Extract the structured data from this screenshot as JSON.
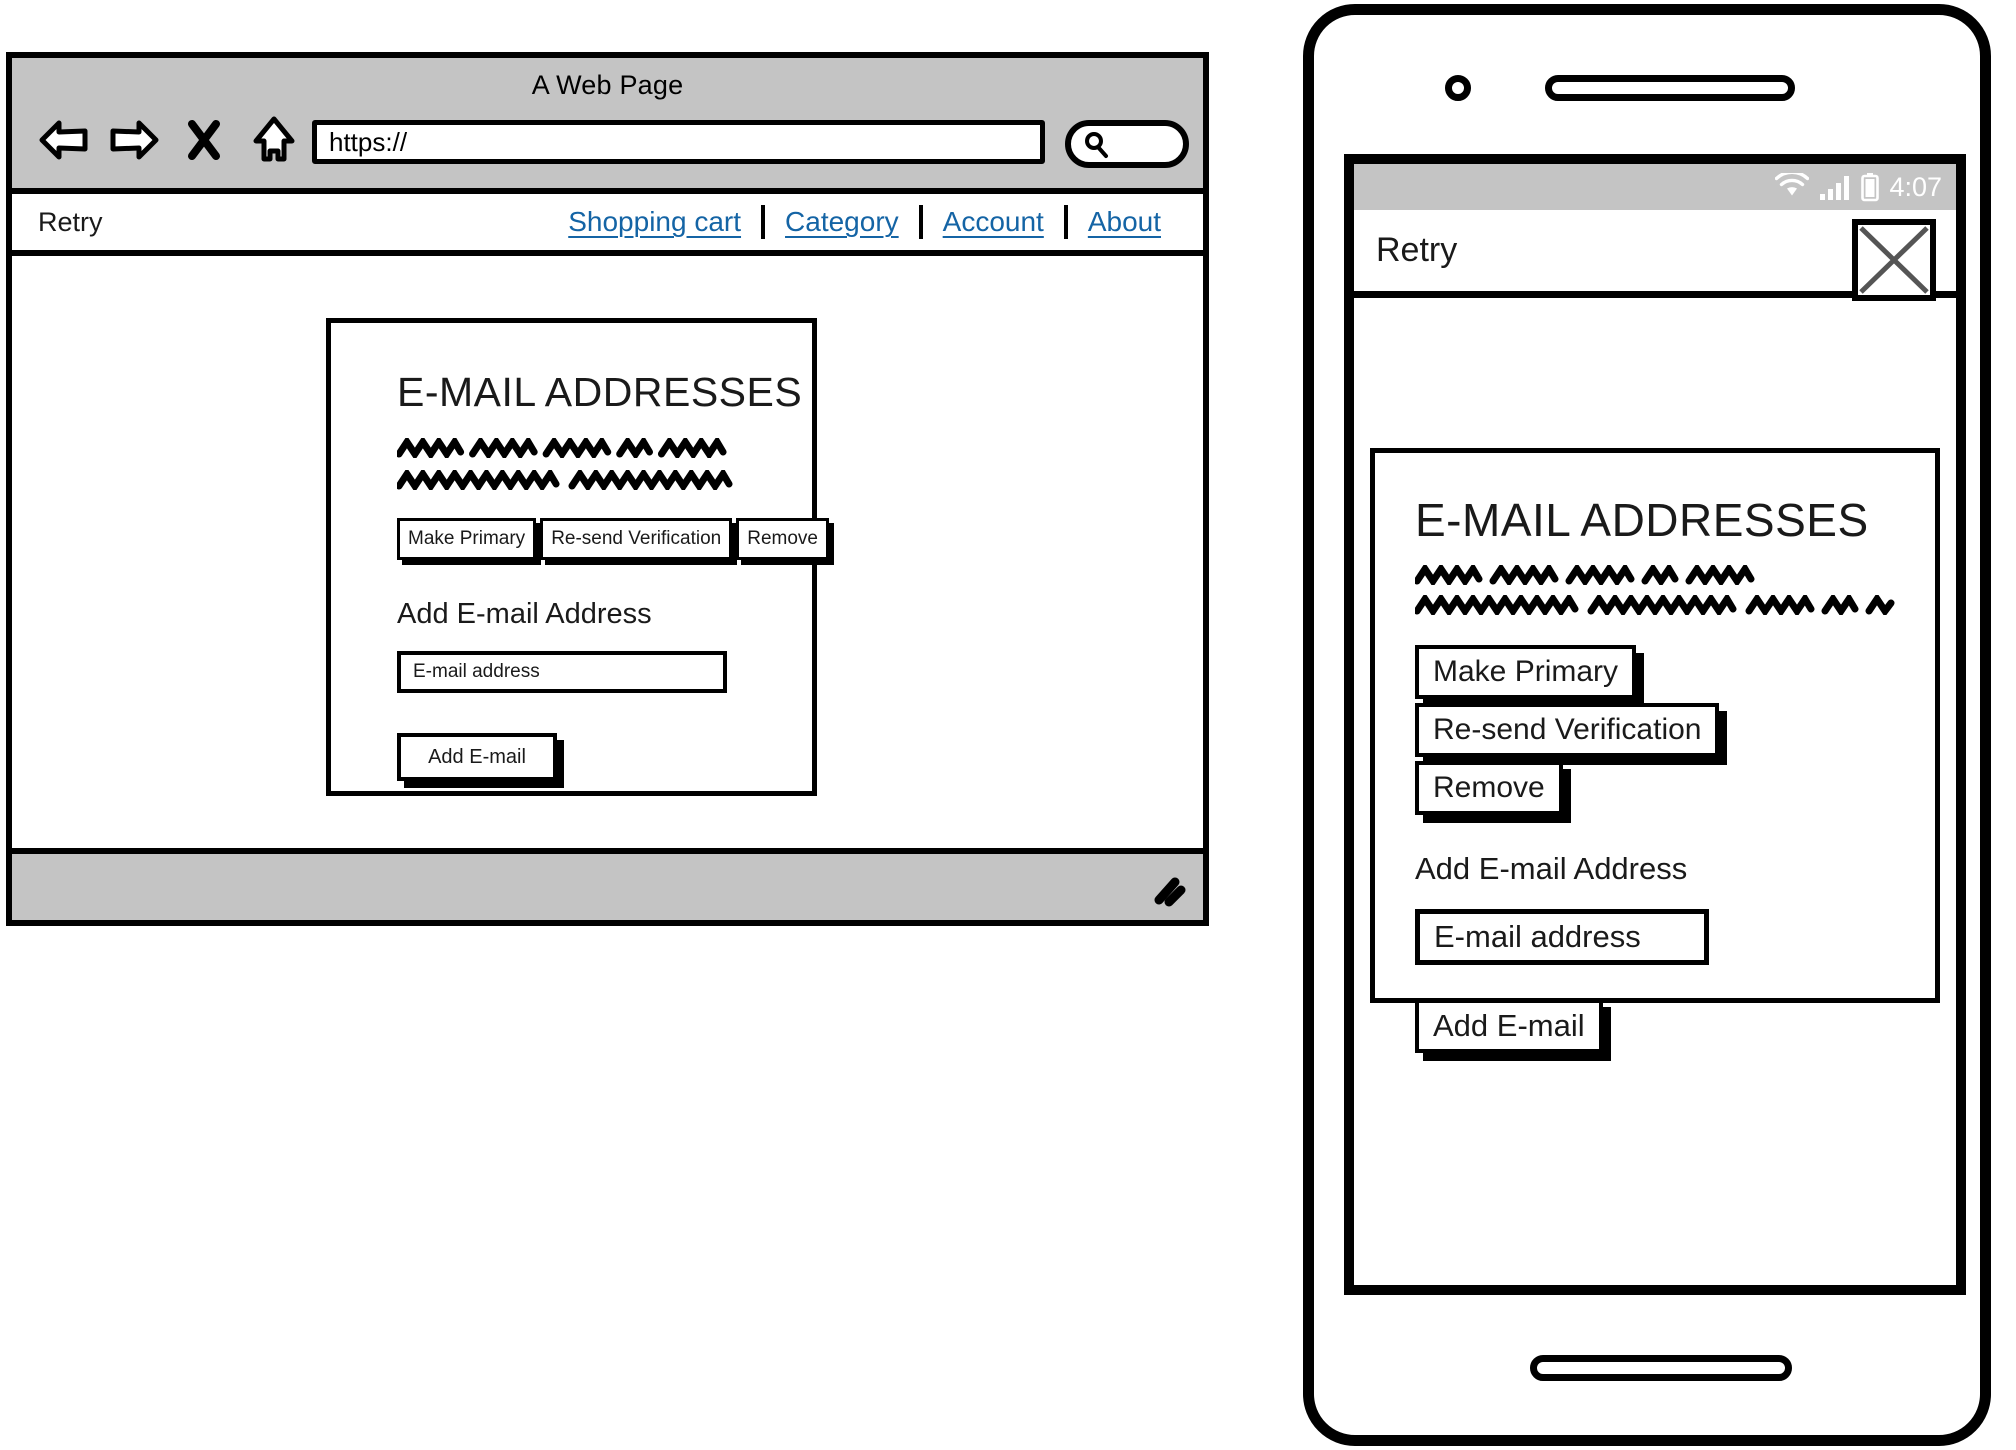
{
  "browser": {
    "title": "A Web Page",
    "url_value": "https://",
    "url_placeholder": "https://",
    "controls": [
      {
        "name": "back-arrow-icon",
        "label": "Back"
      },
      {
        "name": "forward-arrow-icon",
        "label": "Forward"
      },
      {
        "name": "close-x-icon",
        "label": "Stop"
      },
      {
        "name": "home-icon",
        "label": "Home"
      }
    ],
    "search": {
      "icon": "search-icon",
      "value": "",
      "placeholder": ""
    },
    "statusbar": {
      "resize_grip": "resize-grip-icon"
    }
  },
  "site_nav": {
    "brand": "Retry",
    "links": [
      {
        "label": "Shopping cart"
      },
      {
        "label": "Category"
      },
      {
        "label": "Account"
      },
      {
        "label": "About"
      }
    ],
    "link_color": "#1464a5"
  },
  "card": {
    "title": "E-MAIL ADDRESSES",
    "scribble_lines": [
      {
        "segments": [
          5,
          5,
          5,
          3,
          5
        ]
      },
      {
        "segments": [
          11,
          10
        ]
      }
    ],
    "action_buttons": [
      {
        "label": "Make Primary"
      },
      {
        "label": "Re-send Verification"
      },
      {
        "label": "Remove"
      }
    ],
    "add_section_label": "Add E-mail Address",
    "email_input": {
      "value": "E-mail address",
      "placeholder": "E-mail address"
    },
    "submit_label": "Add E-mail"
  },
  "mobile": {
    "status_bar": {
      "time": "4:07",
      "icons": [
        "wifi-icon",
        "cell-signal-icon",
        "battery-icon"
      ],
      "background": "#c4c4c4"
    },
    "header": {
      "brand": "Retry",
      "placeholder_icon": "image-placeholder-icon"
    },
    "card": {
      "title": "E-MAIL ADDRESSES",
      "scribble_lines": [
        {
          "segments": [
            5,
            5,
            5,
            3,
            5
          ]
        },
        {
          "segments": [
            11,
            10,
            5,
            3,
            2
          ]
        }
      ],
      "action_buttons": [
        {
          "label": "Make Primary"
        },
        {
          "label": "Re-send Verification"
        },
        {
          "label": "Remove"
        }
      ],
      "add_section_label": "Add E-mail Address",
      "email_input": {
        "value": "E-mail address",
        "placeholder": "E-mail address"
      },
      "submit_label": "Add E-mail"
    },
    "hardware": {
      "camera": "phone-camera-icon",
      "speaker": "phone-speaker-icon",
      "home_button": "phone-home-button"
    }
  },
  "theme": {
    "ink": "#000000",
    "chrome_gray": "#c4c4c4",
    "paper": "#ffffff"
  }
}
